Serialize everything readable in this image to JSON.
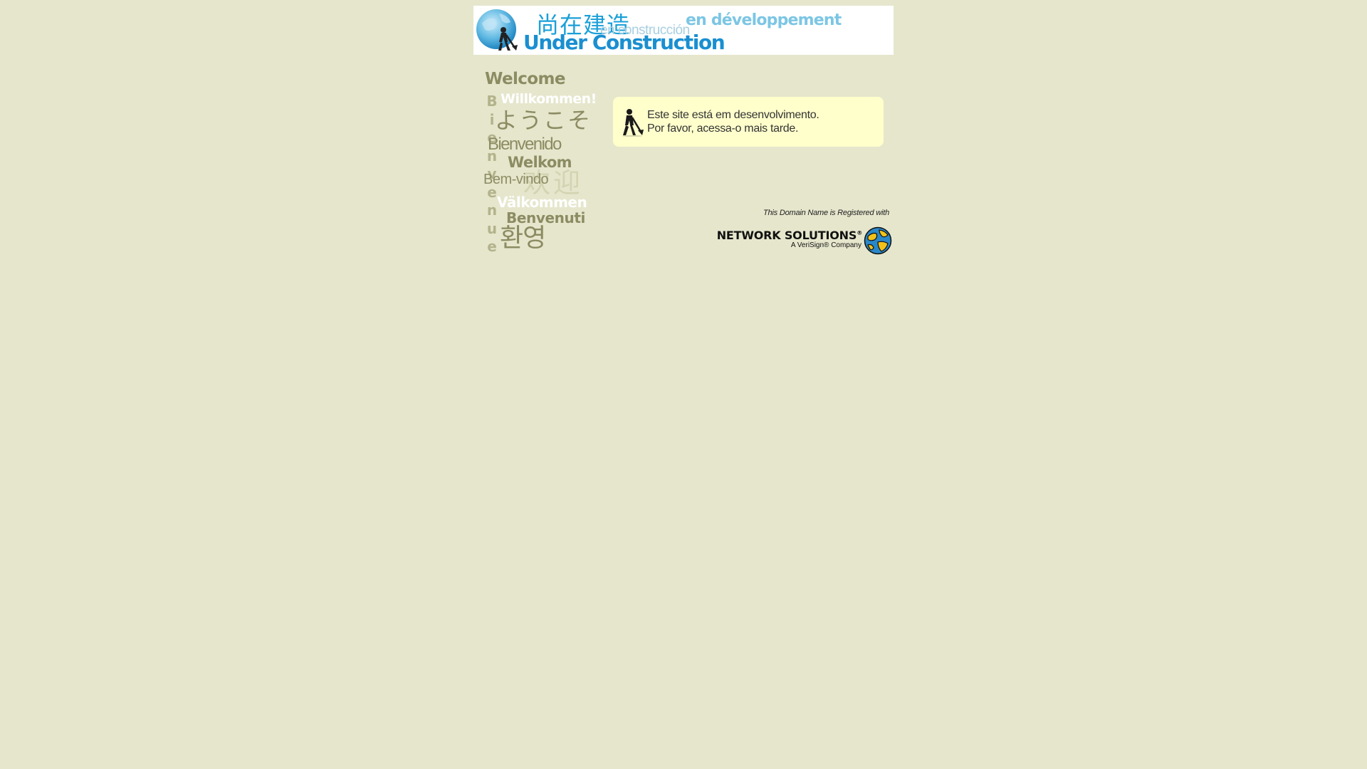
{
  "banner": {
    "title_cjk": "尚在建造",
    "title_es": "en construcción",
    "title_fr": "en développement",
    "title_en": "Under Construction",
    "icon": "globe-worker-icon",
    "accent_color": "#1a8fd0"
  },
  "welcome": {
    "vertical_word": [
      "B",
      "i",
      "e",
      "n",
      "v",
      "e",
      "n",
      "u",
      "e"
    ],
    "words": {
      "en": "Welcome",
      "de": "Willkommen!",
      "ja": "ようこそ",
      "es": "Bienvenido",
      "nl": "Welkom",
      "pt": "Bem-vindo",
      "zh": "欢迎",
      "sv": "Välkommen",
      "it": "Benvenuti",
      "ko": "환영"
    }
  },
  "message": {
    "line1": "Este site está em desenvolvimento.",
    "line2": "Por favor, acessa-o mais tarde.",
    "icon": "construction-worker-icon",
    "background": "#ffffcc"
  },
  "registrar": {
    "caption": "This Domain Name is Registered with",
    "name": "NETWORK SOLUTIONS",
    "registered_mark": "®",
    "subtitle": "A VeriSign® Company",
    "icon": "globe-puzzle-icon"
  },
  "page": {
    "background": "#e6e6cd"
  }
}
